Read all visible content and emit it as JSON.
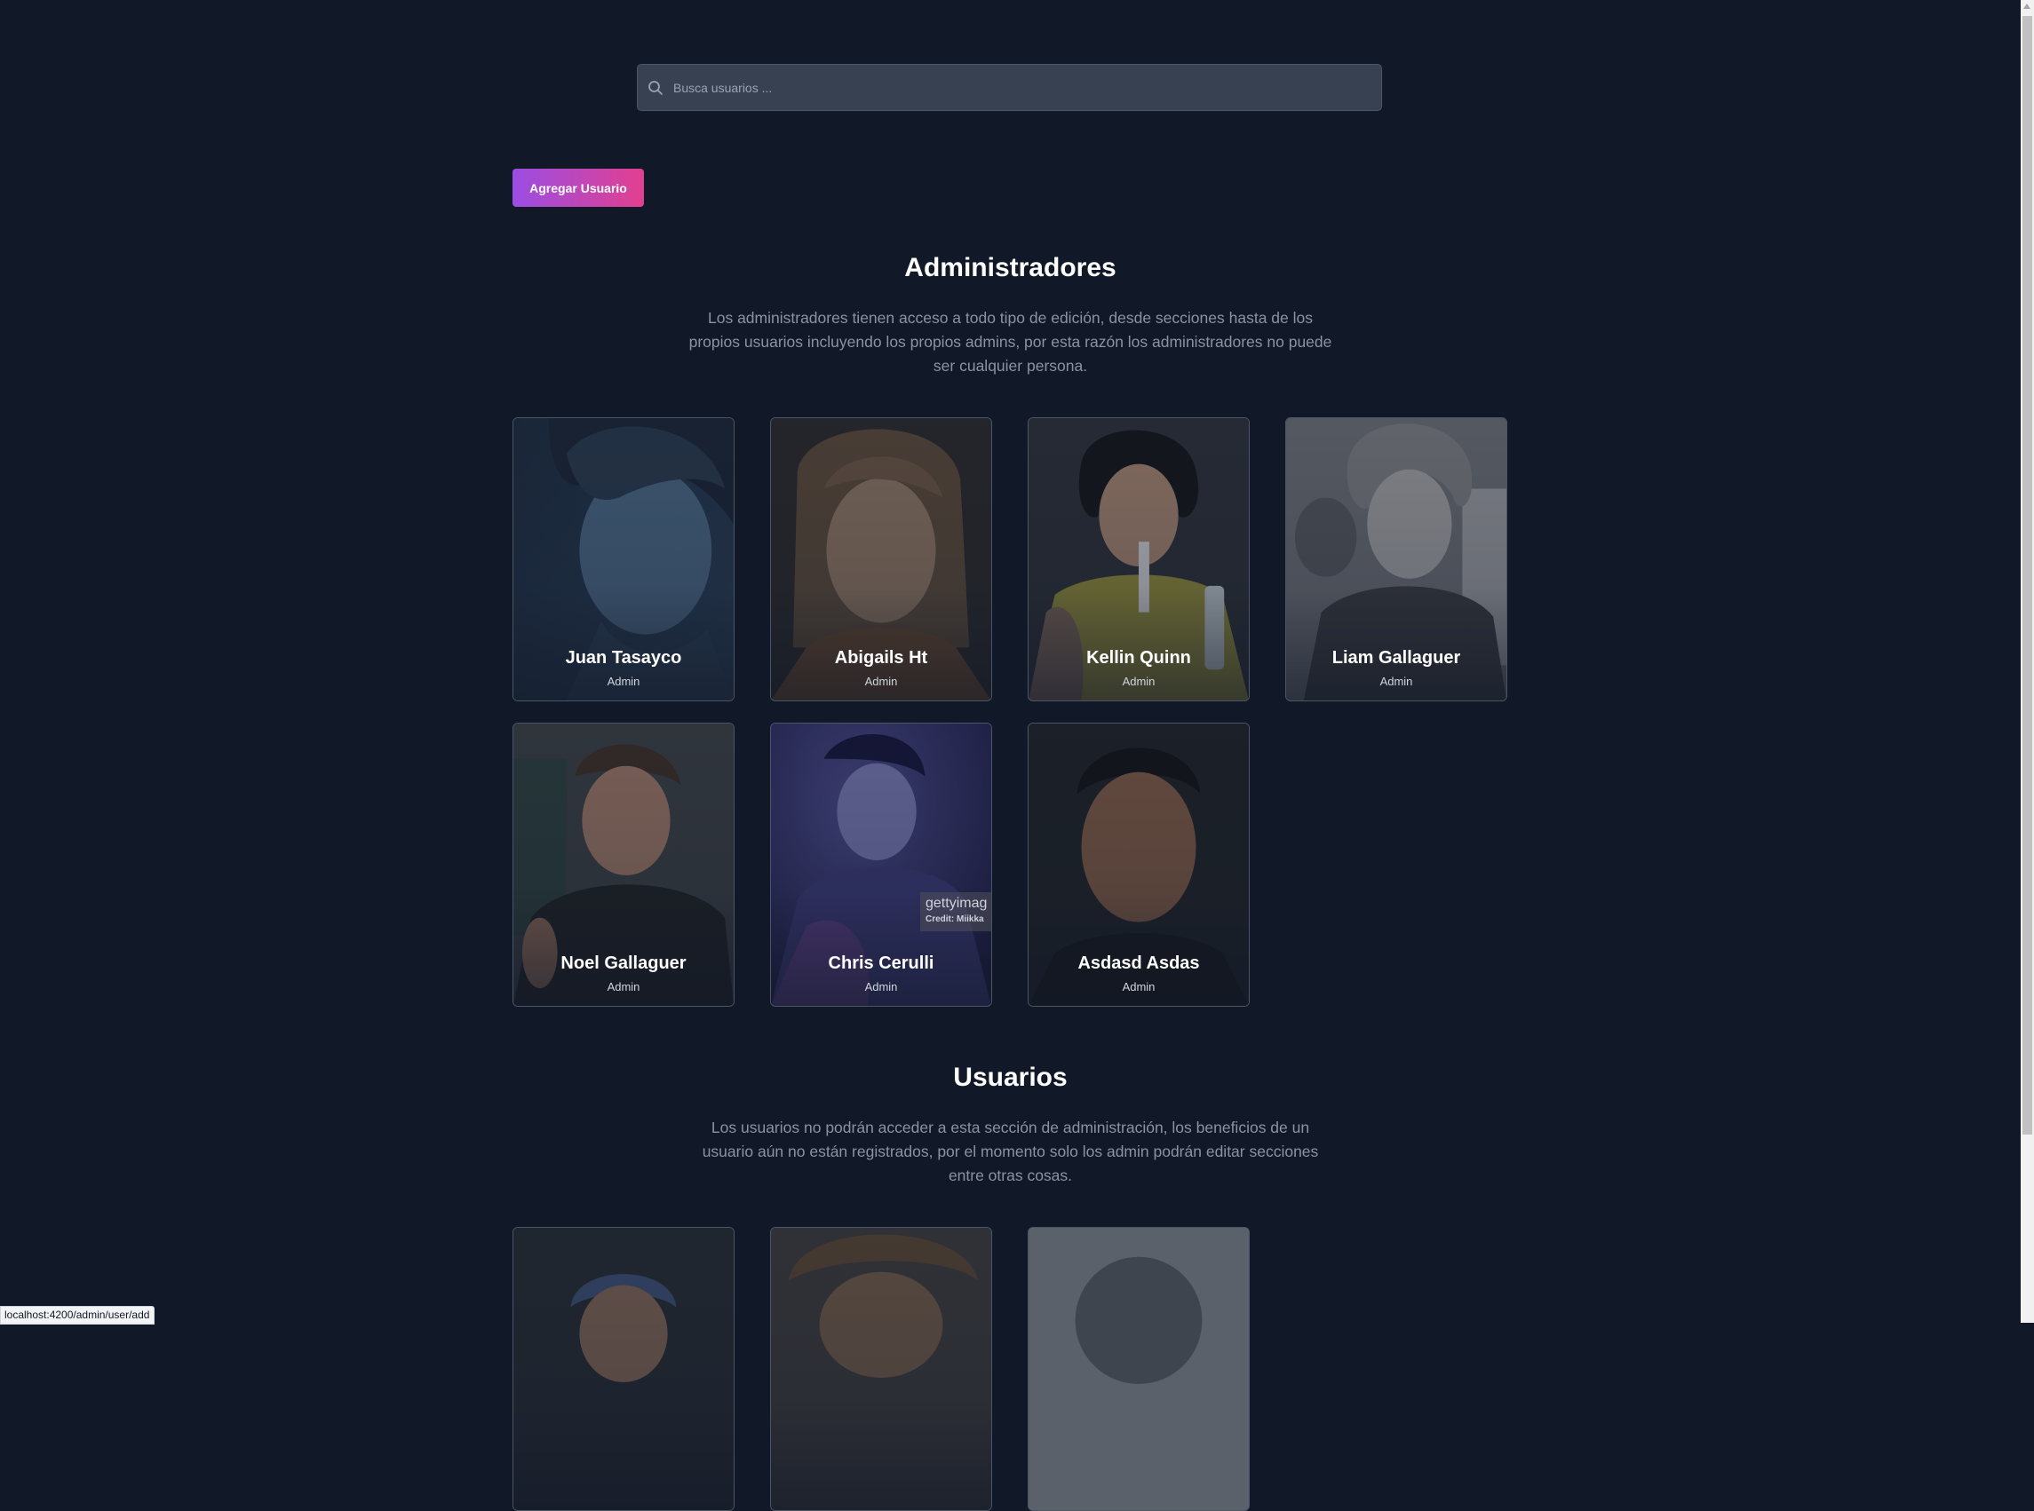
{
  "search": {
    "placeholder": "Busca usuarios ..."
  },
  "toolbar": {
    "add_user_label": "Agregar Usuario"
  },
  "admins_section": {
    "title": "Administradores",
    "description": "Los administradores tienen acceso a todo tipo de edición, desde secciones hasta de los propios usuarios incluyendo los propios admins, por esta razón los administradores no puede ser cualquier persona.",
    "cards": [
      {
        "name": "Juan Tasayco",
        "role": "Admin"
      },
      {
        "name": "Abigails Ht",
        "role": "Admin"
      },
      {
        "name": "Kellin Quinn",
        "role": "Admin"
      },
      {
        "name": "Liam Gallaguer",
        "role": "Admin"
      },
      {
        "name": "Noel Gallaguer",
        "role": "Admin"
      },
      {
        "name": "Chris Cerulli",
        "role": "Admin"
      },
      {
        "name": "Asdasd Asdas",
        "role": "Admin"
      }
    ]
  },
  "users_section": {
    "title": "Usuarios",
    "description": "Los usuarios no podrán acceder a esta sección de administración, los beneficios de un usuario aún no están registrados, por el momento solo los admin podrán editar secciones entre otras cosas."
  },
  "watermark": {
    "brand": "gettyimag",
    "credit": "Credit: Miikka"
  },
  "status_bar": {
    "url": "localhost:4200/admin/user/add"
  },
  "colors": {
    "background": "#111827",
    "button_gradient_start": "#9b4de4",
    "button_gradient_end": "#e2408f"
  }
}
